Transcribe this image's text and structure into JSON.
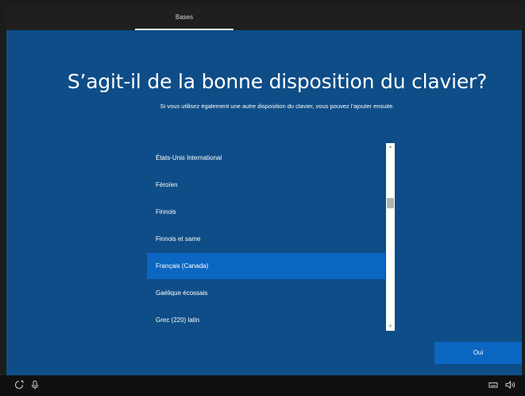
{
  "header": {
    "tabs": [
      {
        "label": "Bases",
        "active": true
      }
    ]
  },
  "main": {
    "title": "S’agit-il de la bonne disposition du clavier?",
    "subtitle": "Si vous utilisez également une autre disposition du clavier, vous pouvez l’ajouter ensuite."
  },
  "layout_list": {
    "items": [
      {
        "label": "États-Unis International",
        "selected": false
      },
      {
        "label": "Féroïen",
        "selected": false
      },
      {
        "label": "Finnois",
        "selected": false
      },
      {
        "label": "Finnois et same",
        "selected": false
      },
      {
        "label": "Français (Canada)",
        "selected": true
      },
      {
        "label": "Gaélique écossais",
        "selected": false
      },
      {
        "label": "Grec (220) latin",
        "selected": false
      }
    ]
  },
  "actions": {
    "confirm_label": "Oui"
  },
  "taskbar": {
    "icons": [
      "ease-of-access-icon",
      "microphone-icon",
      "keyboard-icon",
      "volume-icon"
    ]
  },
  "colors": {
    "background": "#0e4d87",
    "accent": "#0a66c1",
    "topbar": "#1f1f1f",
    "taskbar": "#101010"
  }
}
